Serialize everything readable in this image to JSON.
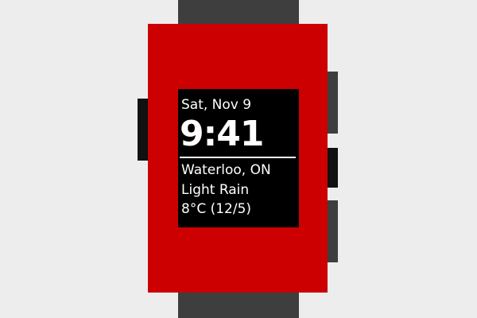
{
  "watchface": {
    "date": "Sat, Nov 9",
    "time": "9:41",
    "location": "Waterloo, ON",
    "condition": "Light Rain",
    "temperature": "8°C (12/5)"
  },
  "colors": {
    "body": "#cc0000",
    "strap": "#3e3e3e",
    "screen": "#000000",
    "text": "#ffffff",
    "background": "#ededed"
  }
}
